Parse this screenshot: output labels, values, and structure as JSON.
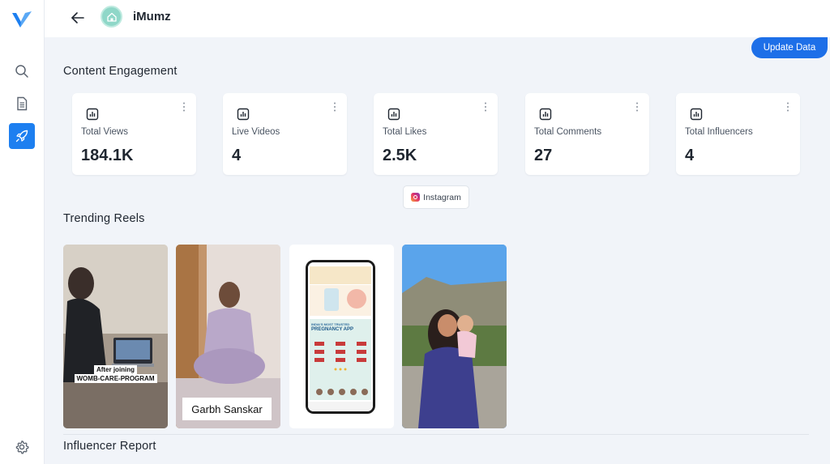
{
  "header": {
    "app_name": "iMumz"
  },
  "update_button": "Update Data",
  "content_engagement": {
    "title": "Content Engagement",
    "cards": [
      {
        "label": "Total Views",
        "value": "184.1K"
      },
      {
        "label": "Live Videos",
        "value": "4"
      },
      {
        "label": "Total Likes",
        "value": "2.5K"
      },
      {
        "label": "Total Comments",
        "value": "27"
      },
      {
        "label": "Total Influencers",
        "value": "4"
      }
    ],
    "platform_pill": "Instagram"
  },
  "trending_reels": {
    "title": "Trending Reels",
    "reel1": {
      "caption_line1": "After joining",
      "caption_line2": "WOMB-CARE-PROGRAM"
    },
    "reel2": {
      "caption": "Garbh Sanskar"
    },
    "reel3": {
      "headline_line1": "INDIA'S MOST TRUSTED",
      "headline_line2": "PREGNANCY APP"
    }
  },
  "influencer_report": {
    "title": "Influencer Report"
  },
  "colors": {
    "accent": "#1d7ff0",
    "update_button": "#1d6fe8",
    "avatar": "#8fd7c8"
  },
  "icons": {
    "sidebar": [
      "search-icon",
      "document-icon",
      "rocket-icon",
      "gear-icon"
    ],
    "card": [
      "bar-chart-icon",
      "kebab-menu-icon"
    ]
  }
}
